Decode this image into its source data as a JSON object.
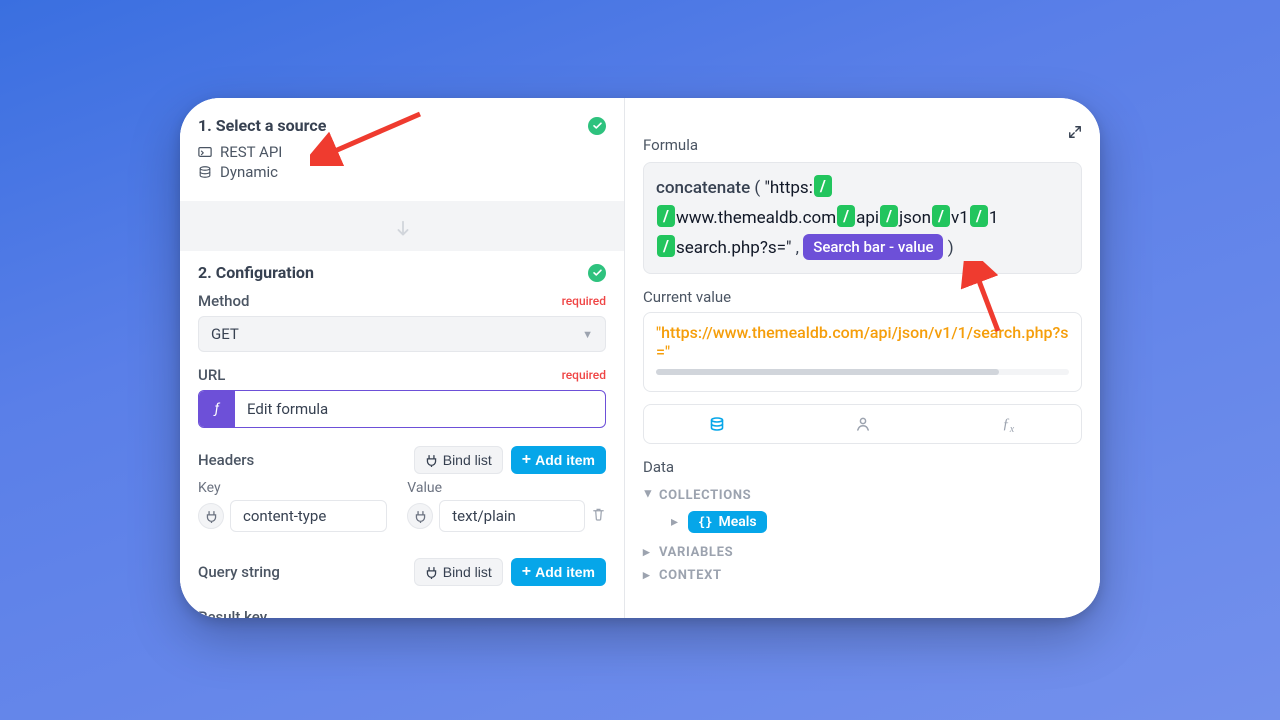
{
  "sections": {
    "source": {
      "title": "1. Select a source",
      "items": [
        "REST API",
        "Dynamic"
      ]
    },
    "config": {
      "title": "2. Configuration",
      "method": {
        "label": "Method",
        "value": "GET",
        "required": "required"
      },
      "url": {
        "label": "URL",
        "value": "Edit formula",
        "required": "required"
      },
      "headers": {
        "label": "Headers",
        "bind": "Bind list",
        "add": "Add item",
        "key_label": "Key",
        "value_label": "Value",
        "row": {
          "key": "content-type",
          "value": "text/plain"
        }
      },
      "query": {
        "label": "Query string",
        "bind": "Bind list",
        "add": "Add item"
      },
      "result": {
        "label": "Result key"
      }
    }
  },
  "right": {
    "formula_label": "Formula",
    "formula": {
      "fn": "concatenate",
      "str1": "\"https:",
      "segA": "www.themealdb.com",
      "segB": "api",
      "segC": "json",
      "segD": "v1",
      "segE": "1",
      "str2": "search.php?s=\"",
      "comma": ",",
      "chip": "Search bar - value"
    },
    "current_label": "Current value",
    "current_value": "\"https://www.themealdb.com/api/json/v1/1/search.php?s=\"",
    "data_label": "Data",
    "tree": {
      "collections": "COLLECTIONS",
      "meals": "Meals",
      "variables": "VARIABLES",
      "context": "CONTEXT"
    }
  }
}
